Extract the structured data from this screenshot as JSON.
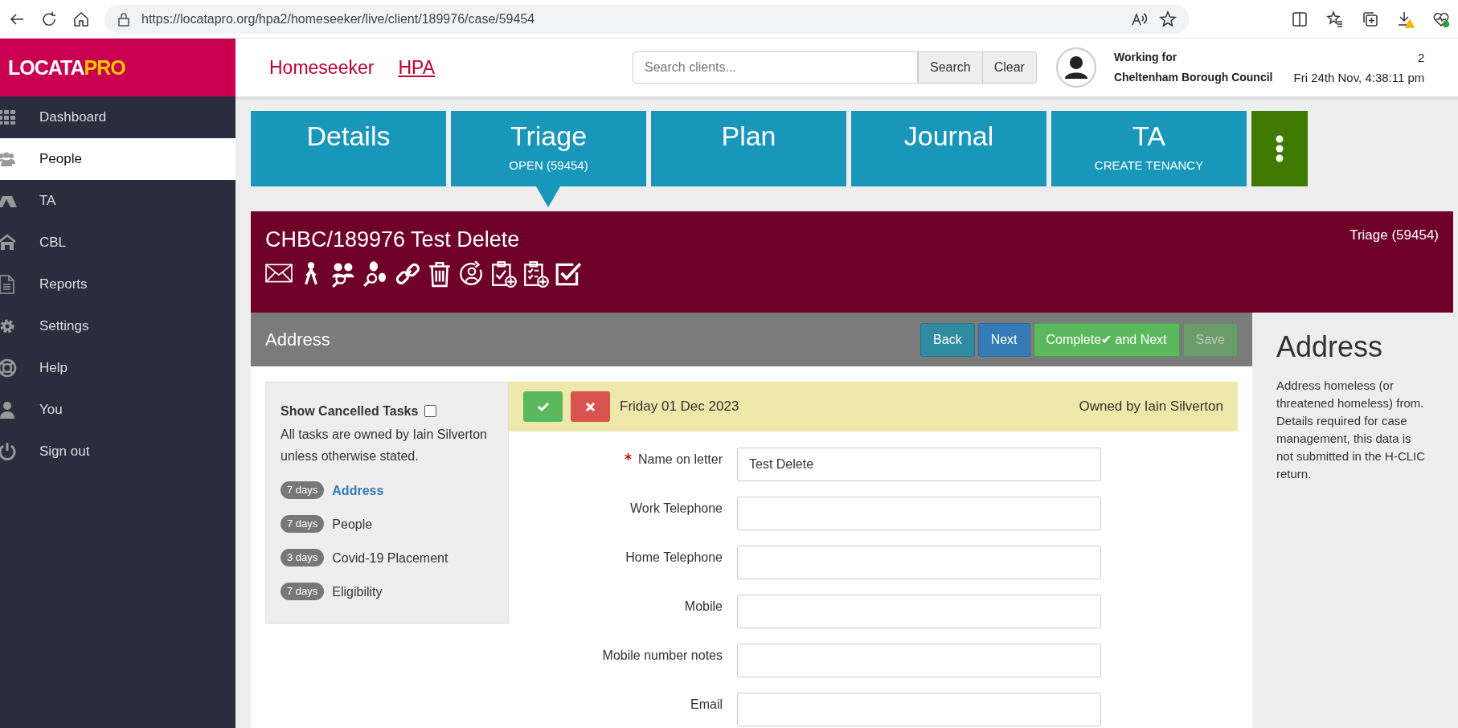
{
  "browser": {
    "url": "https://locatapro.org/hpa2/homeseeker/live/client/189976/case/59454"
  },
  "header": {
    "logo": {
      "first": "LOCATA",
      "second": "PRO"
    },
    "nav": [
      {
        "label": "Homeseeker",
        "kind": "title"
      },
      {
        "label": "HPA",
        "kind": "link"
      }
    ],
    "search": {
      "placeholder": "Search clients...",
      "buttons": [
        "Search",
        "Clear"
      ]
    },
    "working_for_label": "Working for",
    "council": "Cheltenham Borough Council",
    "count": "2",
    "datetime": "Fri 24th Nov, 4:38:11 pm"
  },
  "sidebar": {
    "items": [
      {
        "label": "Dashboard",
        "selected": false
      },
      {
        "label": "People",
        "selected": true
      },
      {
        "label": "TA",
        "selected": false
      },
      {
        "label": "CBL",
        "selected": false
      },
      {
        "label": "Reports",
        "selected": false
      },
      {
        "label": "Settings",
        "selected": false
      },
      {
        "label": "Help",
        "selected": false
      },
      {
        "label": "You",
        "selected": false
      },
      {
        "label": "Sign out",
        "selected": false
      }
    ]
  },
  "tabs": [
    {
      "title": "Details",
      "selected": false
    },
    {
      "title": "Triage",
      "subtitle": "OPEN (59454)",
      "selected": true
    },
    {
      "title": "Plan",
      "selected": false
    },
    {
      "title": "Journal",
      "selected": false
    },
    {
      "title": "TA",
      "subtitle": "CREATE TENANCY",
      "selected": false
    }
  ],
  "case": {
    "title": "CHBC/189976 Test Delete",
    "stage": "Triage (59454)"
  },
  "section": {
    "title": "Address",
    "buttons": [
      {
        "label": "Back",
        "kind": "back",
        "disabled": false
      },
      {
        "label": "Next",
        "kind": "primary",
        "disabled": false
      },
      {
        "label": "Complete✔ and Next",
        "kind": "success",
        "disabled": false
      },
      {
        "label": "Save",
        "kind": "success",
        "disabled": true
      }
    ]
  },
  "tasks": {
    "show_cancelled": {
      "label": "Show Cancelled Tasks",
      "checked": false
    },
    "note": "All tasks are owned by Iain Silverton unless otherwise stated.",
    "items": [
      {
        "days": "7 days",
        "name": "Address",
        "selected": true
      },
      {
        "days": "7 days",
        "name": "People",
        "selected": false
      },
      {
        "days": "3 days",
        "name": "Covid-19 Placement",
        "selected": false
      },
      {
        "days": "7 days",
        "name": "Eligibility",
        "selected": false
      }
    ]
  },
  "task_bar": {
    "date": "Friday 01 Dec 2023",
    "owner": "Owned by Iain Silverton"
  },
  "form": {
    "fields": [
      {
        "label": "Name on letter",
        "required": true,
        "value": "Test Delete"
      },
      {
        "label": "Work Telephone",
        "required": false
      },
      {
        "label": "Home Telephone",
        "required": false
      },
      {
        "label": "Mobile",
        "required": false
      },
      {
        "label": "Mobile number notes",
        "required": false
      },
      {
        "label": "Email",
        "required": false
      }
    ]
  },
  "help": {
    "title": "Address",
    "text": "Address homeless (or threatened homeless) from. Details required for case management, this data is not submitted in the H-CLIC return."
  }
}
